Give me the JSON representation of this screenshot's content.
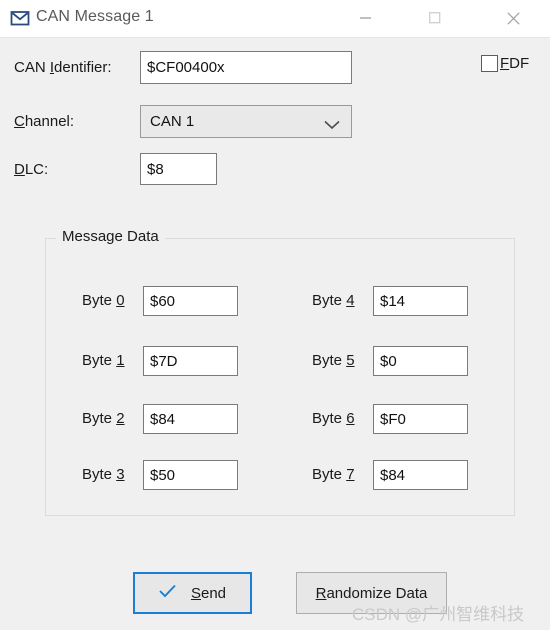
{
  "window": {
    "title": "CAN Message 1",
    "icon": "envelope-icon",
    "controls": {
      "minimize": "—",
      "maximize": "□",
      "close": "✕"
    }
  },
  "form": {
    "identifier": {
      "label_pre": "CAN ",
      "label_acc": "I",
      "label_post": "dentifier:",
      "value": "$CF00400x"
    },
    "channel": {
      "label_acc": "C",
      "label_post": "hannel:",
      "value": "CAN 1",
      "arrow": "chevron-down-icon"
    },
    "dlc": {
      "label_acc": "D",
      "label_post": "LC:",
      "value": "$8"
    },
    "fdf": {
      "label_acc": "F",
      "label_post": "DF",
      "checked": false
    }
  },
  "message_data": {
    "group_title": "Message Data",
    "bytes": [
      {
        "prefix": "Byte ",
        "index": "0",
        "value": "$60"
      },
      {
        "prefix": "Byte ",
        "index": "1",
        "value": "$7D"
      },
      {
        "prefix": "Byte ",
        "index": "2",
        "value": "$84"
      },
      {
        "prefix": "Byte ",
        "index": "3",
        "value": "$50"
      },
      {
        "prefix": "Byte ",
        "index": "4",
        "value": "$14"
      },
      {
        "prefix": "Byte ",
        "index": "5",
        "value": "$0"
      },
      {
        "prefix": "Byte ",
        "index": "6",
        "value": "$F0"
      },
      {
        "prefix": "Byte ",
        "index": "7",
        "value": "$84"
      }
    ]
  },
  "footer": {
    "send": {
      "icon": "check-icon",
      "label_acc": "S",
      "label_post": "end"
    },
    "randomize": {
      "label_acc": "R",
      "label_post": "andomize Data"
    }
  },
  "watermark": {
    "text": "CSDN @广州智维科技"
  },
  "colors": {
    "accent": "#1a7fd4",
    "window_bg": "#f0f0f0",
    "titlebar_bg": "#ffffff",
    "field_bg": "#ffffff",
    "button_bg": "#e7e7e7"
  }
}
